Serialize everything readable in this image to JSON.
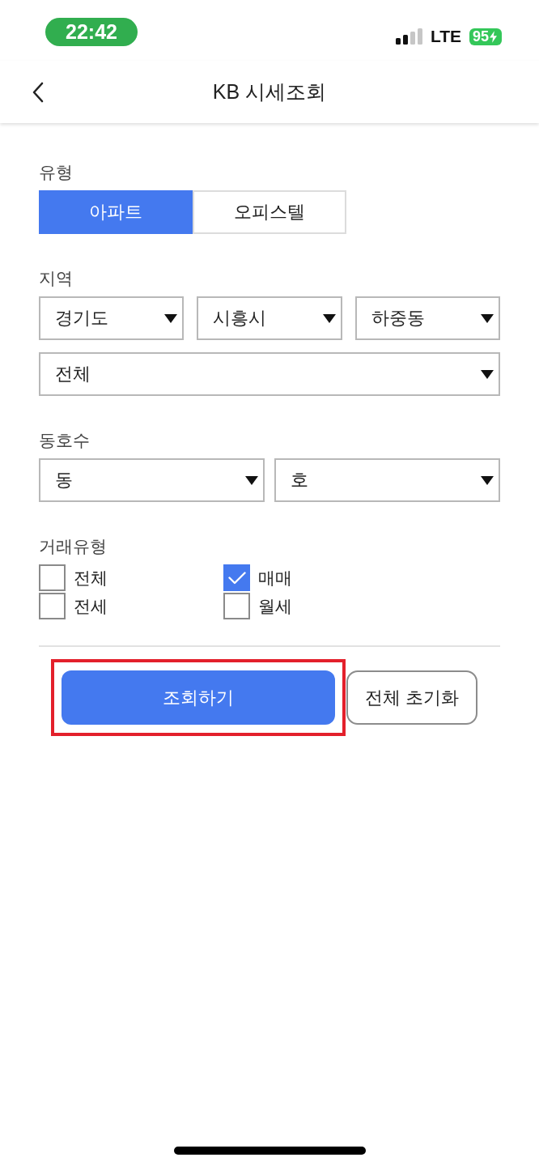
{
  "status_bar": {
    "time": "22:42",
    "network": "LTE",
    "battery": "95"
  },
  "nav": {
    "title": "KB 시세조회"
  },
  "sections": [
    {
      "kind": "segmented",
      "label": "유형",
      "options": [
        {
          "label": "아파트",
          "selected": true
        },
        {
          "label": "오피스텔",
          "selected": false
        }
      ]
    },
    {
      "kind": "dropdowns",
      "label": "지역",
      "rows": [
        [
          "경기도",
          "시흥시",
          "하중동"
        ],
        [
          "전체"
        ]
      ]
    },
    {
      "kind": "dropdowns",
      "label": "동호수",
      "rows": [
        [
          "동",
          "호"
        ]
      ]
    },
    {
      "kind": "checkboxes",
      "label": "거래유형",
      "items": [
        {
          "label": "전체",
          "checked": false
        },
        {
          "label": "매매",
          "checked": true
        },
        {
          "label": "전세",
          "checked": false
        },
        {
          "label": "월세",
          "checked": false
        }
      ]
    }
  ],
  "buttons": [
    {
      "kind": "primary",
      "label": "조회하기",
      "highlighted": true
    },
    {
      "kind": "secondary",
      "label": "전체 초기화",
      "highlighted": false
    }
  ]
}
